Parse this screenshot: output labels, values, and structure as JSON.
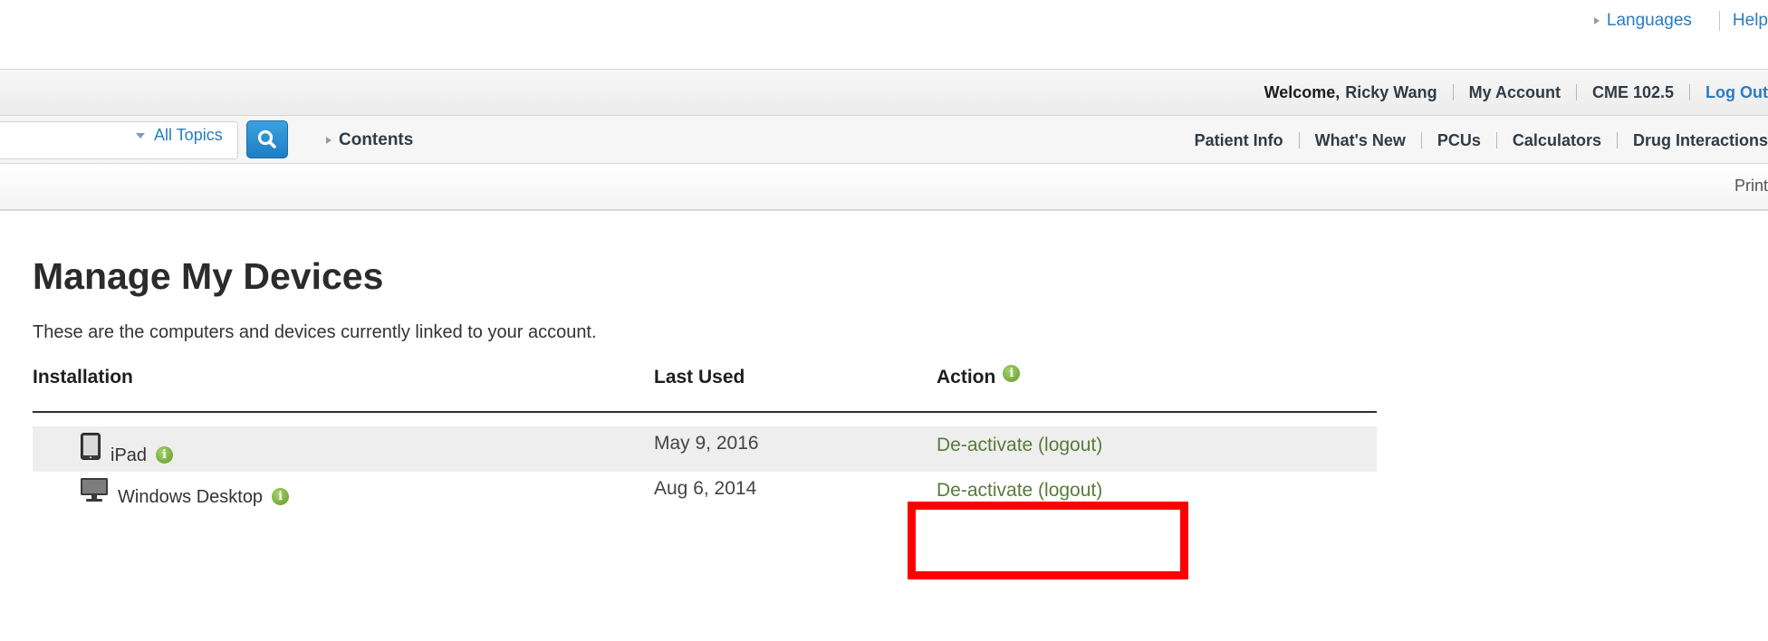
{
  "utility_nav": {
    "languages_label": "Languages",
    "help_label": "Help"
  },
  "welcome_bar": {
    "greeting_prefix": "Welcome,",
    "user_name": "Ricky Wang",
    "my_account_label": "My Account",
    "cme_label": "CME 102.5",
    "logout_label": "Log Out"
  },
  "search": {
    "input_value": "",
    "topic_filter_label": "All Topics",
    "contents_label": "Contents"
  },
  "main_nav": {
    "items": [
      "Patient Info",
      "What's New",
      "PCUs",
      "Calculators",
      "Drug Interactions"
    ]
  },
  "toolbar": {
    "print_label": "Print"
  },
  "page": {
    "title": "Manage My Devices",
    "intro": "These are the computers and devices currently linked to your account."
  },
  "table": {
    "headers": {
      "installation": "Installation",
      "last_used": "Last Used",
      "action": "Action"
    },
    "rows": [
      {
        "device": "iPad",
        "icon": "tablet-icon",
        "last_used": "May 9, 2016",
        "action": "De-activate (logout)"
      },
      {
        "device": "Windows Desktop",
        "icon": "desktop-monitor-icon",
        "last_used": "Aug 6, 2014",
        "action": "De-activate (logout)"
      }
    ]
  },
  "colors": {
    "link_blue": "#2a7cbf",
    "action_green": "#5a7a3a",
    "info_green": "#6aa531",
    "highlight_red": "#ff0000",
    "search_button_blue": "#2a8fd3"
  }
}
